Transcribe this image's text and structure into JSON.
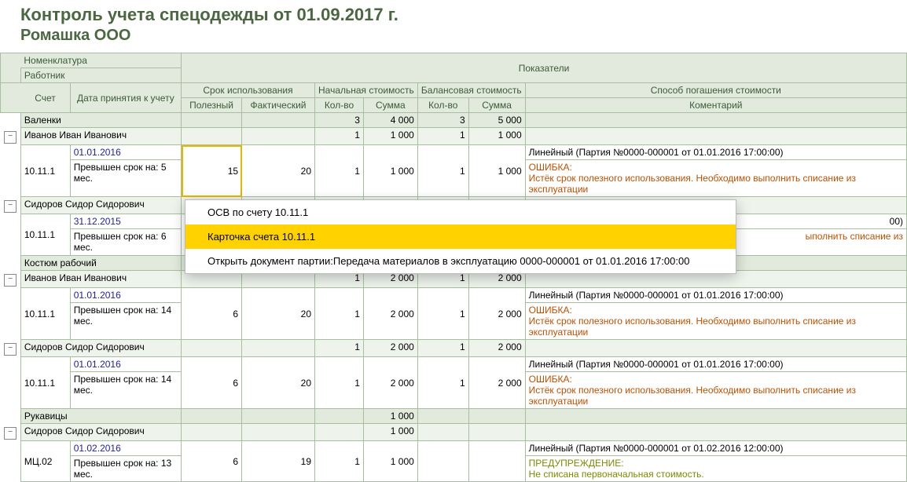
{
  "titles": {
    "line1": "Контроль учета спецодежды от 01.09.2017 г.",
    "line2": "Ромашка ООО"
  },
  "header": {
    "nomenclature": "Номенклатура",
    "worker": "Работник",
    "indicators": "Показатели",
    "account": "Счет",
    "accept_date": "Дата принятия к учету",
    "usage": "Срок использования",
    "initial_cost": "Начальная стоимость",
    "balance_cost": "Балансовая стоимость",
    "repay": "Способ погашения стоимости",
    "useful": "Полезный",
    "actual": "Фактический",
    "qty": "Кол-во",
    "sum": "Сумма",
    "comment": "Коментарий"
  },
  "groups": [
    {
      "name": "Валенки",
      "init_qty": "3",
      "init_sum": "4 000",
      "bal_qty": "3",
      "bal_sum": "5 000",
      "workers": [
        {
          "name": "Иванов Иван Иванович",
          "init_qty": "1",
          "init_sum": "1 000",
          "bal_qty": "1",
          "bal_sum": "1 000",
          "rows": [
            {
              "account": "10.11.1",
              "date": "01.01.2016",
              "overdue": "Превышен срок на: 5 мес.",
              "useful": "15",
              "actual": "20",
              "init_qty": "1",
              "init_sum": "1 000",
              "bal_qty": "1",
              "bal_sum": "1 000",
              "repay": "Линейный (Партия №0000-000001 от 01.01.2016 17:00:00)",
              "err_label": "ОШИБКА:",
              "err_text": "Истёк срок полезного использования. Необходимо выполнить списание из эксплуатации"
            }
          ]
        },
        {
          "name": "Сидоров Сидор Сидорович",
          "init_qty": "",
          "init_sum": "",
          "bal_qty": "",
          "bal_sum": "",
          "rows": [
            {
              "account": "10.11.1",
              "date": "31.12.2015",
              "overdue": "Превышен срок на: 6 мес.",
              "useful": "",
              "actual": "",
              "init_qty": "",
              "init_sum": "",
              "bal_qty": "",
              "bal_sum": "",
              "repay_tail": "00)",
              "err_label": "",
              "err_text_tail": "ыполнить списание из"
            }
          ]
        }
      ]
    },
    {
      "name": "Костюм рабочий",
      "init_qty": "",
      "init_sum": "",
      "bal_qty": "",
      "bal_sum": "",
      "workers": [
        {
          "name": "Иванов Иван Иванович",
          "init_qty": "1",
          "init_sum": "2 000",
          "bal_qty": "1",
          "bal_sum": "2 000",
          "rows": [
            {
              "account": "10.11.1",
              "date": "01.01.2016",
              "overdue": "Превышен срок на: 14 мес.",
              "useful": "6",
              "actual": "20",
              "init_qty": "1",
              "init_sum": "2 000",
              "bal_qty": "1",
              "bal_sum": "2 000",
              "repay": "Линейный (Партия №0000-000001 от 01.01.2016 17:00:00)",
              "err_label": "ОШИБКА:",
              "err_text": "Истёк срок полезного использования. Необходимо выполнить списание из эксплуатации"
            }
          ]
        },
        {
          "name": "Сидоров Сидор Сидорович",
          "init_qty": "1",
          "init_sum": "2 000",
          "bal_qty": "1",
          "bal_sum": "2 000",
          "rows": [
            {
              "account": "10.11.1",
              "date": "01.01.2016",
              "overdue": "Превышен срок на: 14 мес.",
              "useful": "6",
              "actual": "20",
              "init_qty": "1",
              "init_sum": "2 000",
              "bal_qty": "1",
              "bal_sum": "2 000",
              "repay": "Линейный (Партия №0000-000001 от 01.01.2016 17:00:00)",
              "err_label": "ОШИБКА:",
              "err_text": "Истёк срок полезного использования. Необходимо выполнить списание из эксплуатации"
            }
          ]
        }
      ]
    },
    {
      "name": "Рукавицы",
      "init_qty": "",
      "init_sum": "1 000",
      "bal_qty": "",
      "bal_sum": "",
      "workers": [
        {
          "name": "Сидоров Сидор Сидорович",
          "init_qty": "",
          "init_sum": "1 000",
          "bal_qty": "",
          "bal_sum": "",
          "rows": [
            {
              "account": "МЦ.02",
              "date": "01.02.2016",
              "overdue": "Превышен срок на: 13 мес.",
              "useful": "6",
              "actual": "19",
              "init_qty": "1",
              "init_sum": "1 000",
              "bal_qty": "",
              "bal_sum": "",
              "repay": "Линейный (Партия №0000-000001 от 01.02.2016 12:00:00)",
              "warn_label": "ПРЕДУПРЕЖДЕНИЕ:",
              "warn_text": "Не списана первоначальная стоимость."
            }
          ]
        }
      ]
    }
  ],
  "context_menu": {
    "items": [
      "ОСВ по счету 10.11.1",
      "Карточка счета 10.11.1",
      "Открыть документ партии:Передача материалов в эксплуатацию 0000-000001 от 01.01.2016 17:00:00"
    ],
    "highlighted": 1
  },
  "glyphs": {
    "minus": "−"
  }
}
